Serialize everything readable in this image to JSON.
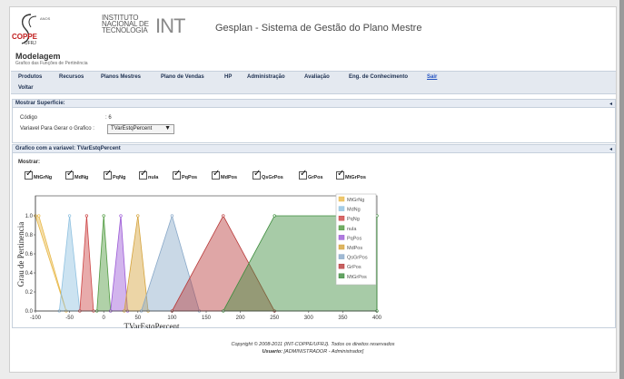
{
  "header": {
    "logo_coppe": "COPPE",
    "logo_ufrj": "UFRJ",
    "logo_anos": "ANOS",
    "logo_int_text": "INSTITUTO NACIONAL DE TECNOLOGIA",
    "logo_int_mark": "INT",
    "app_title": "Gesplan - Sistema de Gestão do Plano Mestre"
  },
  "page": {
    "title": "Modelagem",
    "subtitle": "Grafico das Funções de Pertinência"
  },
  "menu": {
    "items": [
      "Produtos",
      "Recursos",
      "Planos Mestres",
      "Plano de Vendas",
      "HP",
      "Administração",
      "Avaliação",
      "Eng. de Conhecimento"
    ],
    "sair": "Sair",
    "voltar": "Voltar"
  },
  "surface_panel": {
    "title": "Mostrar Superficie:",
    "codigo_label": "Código",
    "codigo_value": ": 6",
    "variable_label": "Variavel Para Gerar o Grafico :",
    "variable_value": "TVarEstqPercent"
  },
  "chart_panel": {
    "title": "Grafico com a variavel: TVarEstqPercent",
    "show_label": "Mostrar:",
    "checkboxes": [
      "MtGrNg",
      "MdNg",
      "PqNg",
      "nula",
      "PqPos",
      "MdPos",
      "QsGrPos",
      "GrPos",
      "MtGrPos"
    ]
  },
  "chart_data": {
    "type": "area",
    "xlabel": "TVarEstqPercent",
    "ylabel": "Grau de Pertinencia",
    "xlim": [
      -100,
      400
    ],
    "ylim": [
      0,
      1.0
    ],
    "xticks": [
      "-100",
      "-50",
      "0",
      "50",
      "100",
      "150",
      "200",
      "250",
      "300",
      "350",
      "400"
    ],
    "yticks": [
      "0.0",
      "0.2",
      "0.4",
      "0.6",
      "0.8",
      "1.0"
    ],
    "series": [
      {
        "name": "MtGrNg",
        "color": "#e8b94a",
        "points": [
          [
            -100,
            1
          ],
          [
            -95,
            1
          ],
          [
            -55,
            0
          ]
        ]
      },
      {
        "name": "MdNg",
        "color": "#8fc1e0",
        "points": [
          [
            -65,
            0
          ],
          [
            -50,
            1
          ],
          [
            -35,
            0
          ]
        ]
      },
      {
        "name": "PqNg",
        "color": "#cc4444",
        "points": [
          [
            -35,
            0
          ],
          [
            -25,
            1
          ],
          [
            -15,
            0
          ]
        ]
      },
      {
        "name": "nula",
        "color": "#4f9a3f",
        "points": [
          [
            -10,
            0
          ],
          [
            0,
            1
          ],
          [
            10,
            0
          ]
        ]
      },
      {
        "name": "PqPos",
        "color": "#9b59d6",
        "points": [
          [
            10,
            0
          ],
          [
            25,
            1
          ],
          [
            35,
            0
          ]
        ]
      },
      {
        "name": "MdPos",
        "color": "#d4a23a",
        "points": [
          [
            30,
            0
          ],
          [
            50,
            1
          ],
          [
            65,
            0
          ]
        ]
      },
      {
        "name": "QsGrPos",
        "color": "#88a8c8",
        "points": [
          [
            55,
            0
          ],
          [
            100,
            1
          ],
          [
            140,
            0
          ]
        ]
      },
      {
        "name": "GrPos",
        "color": "#b83a3a",
        "points": [
          [
            100,
            0
          ],
          [
            175,
            1
          ],
          [
            250,
            0
          ]
        ]
      },
      {
        "name": "MtGrPos",
        "color": "#3c8c3c",
        "points": [
          [
            175,
            0
          ],
          [
            250,
            1
          ],
          [
            400,
            1
          ],
          [
            400,
            0
          ]
        ]
      }
    ]
  },
  "footer": {
    "copyright": "Copyright © 2008-2011 (INT-COPPE/UFRJ). Todos os direitos reservados",
    "user_label": "Usuario:",
    "user_value": "[ADMINISTRADOR - Administrador]"
  }
}
